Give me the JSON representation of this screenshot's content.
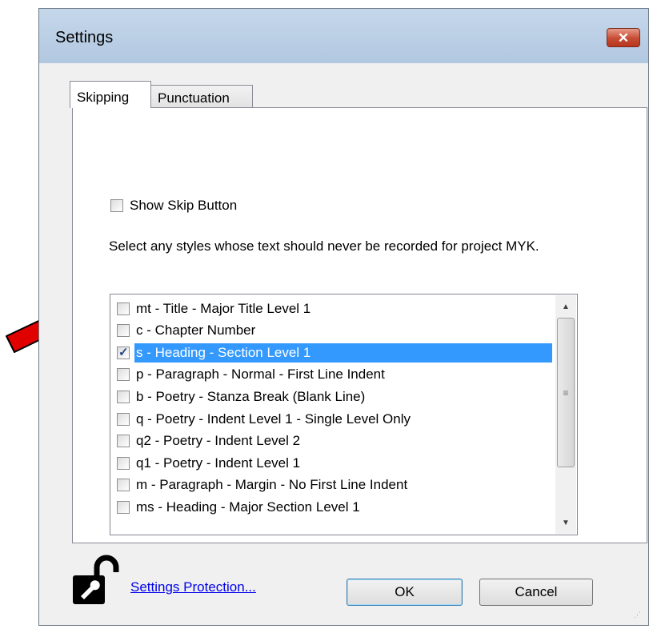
{
  "window": {
    "title": "Settings",
    "close_symbol": "✕"
  },
  "tabs": [
    {
      "label": "Skipping",
      "active": true
    },
    {
      "label": "Punctuation",
      "active": false
    }
  ],
  "show_skip": {
    "label": "Show Skip Button",
    "checked": false
  },
  "description": "Select any styles whose text should never be recorded for project MYK.",
  "styles": [
    {
      "label": "mt - Title - Major Title Level 1",
      "checked": false,
      "selected": false
    },
    {
      "label": "c - Chapter Number",
      "checked": false,
      "selected": false
    },
    {
      "label": "s - Heading - Section Level 1",
      "checked": true,
      "selected": true
    },
    {
      "label": "p - Paragraph - Normal - First Line Indent",
      "checked": false,
      "selected": false
    },
    {
      "label": "b - Poetry - Stanza Break (Blank Line)",
      "checked": false,
      "selected": false
    },
    {
      "label": "q - Poetry - Indent Level 1 - Single Level Only",
      "checked": false,
      "selected": false
    },
    {
      "label": "q2 - Poetry - Indent Level 2",
      "checked": false,
      "selected": false
    },
    {
      "label": "q1 - Poetry - Indent Level 1",
      "checked": false,
      "selected": false
    },
    {
      "label": "m - Paragraph - Margin - No First Line Indent",
      "checked": false,
      "selected": false
    },
    {
      "label": "ms - Heading - Major Section Level 1",
      "checked": false,
      "selected": false
    }
  ],
  "footer": {
    "protection_link": "Settings Protection...",
    "ok": "OK",
    "cancel": "Cancel"
  },
  "colors": {
    "selection": "#3399ff",
    "link": "#0000ee",
    "arrow": "#e00000"
  }
}
